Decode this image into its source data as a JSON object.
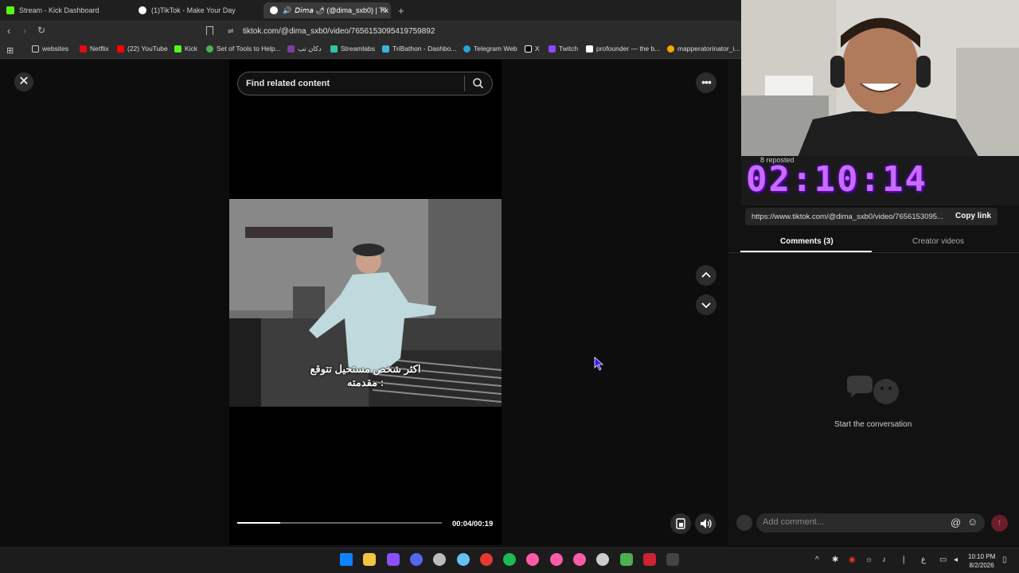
{
  "tabs": [
    {
      "title": "Stream - Kick Dashboard",
      "color": "#53fc18"
    },
    {
      "title": "(1)TikTok - Make Your Day",
      "color": "#ffffff"
    },
    {
      "title": "𝘋𝘪𝘮𝘢 🌶 (@dima_sxb0) | Tik",
      "color": "#ffffff"
    }
  ],
  "address": {
    "url": "tiktok.com/@dima_sxb0/video/7656153095419759892"
  },
  "bookmarks": [
    {
      "label": "websites",
      "color": "#cccccc"
    },
    {
      "label": "Netflix",
      "color": "#e50914"
    },
    {
      "label": "(22) YouTube",
      "color": "#ff0000"
    },
    {
      "label": "Kick",
      "color": "#53fc18"
    },
    {
      "label": "Set of Tools to Help...",
      "color": "#4caf50"
    },
    {
      "label": "دكان تب",
      "color": "#7b3fa0"
    },
    {
      "label": "Streamlabs",
      "color": "#31c3a2"
    },
    {
      "label": "TriBathon - Dashbo...",
      "color": "#3ab5d8"
    },
    {
      "label": "Telegram Web",
      "color": "#2aa1da"
    },
    {
      "label": "X",
      "color": "#ffffff"
    },
    {
      "label": "Twitch",
      "color": "#9146ff"
    },
    {
      "label": "profounder — the b...",
      "color": "#ffffff"
    },
    {
      "label": "mapperatorinator_i...",
      "color": "#f7a600"
    }
  ],
  "search": {
    "placeholder": "Find related content"
  },
  "video": {
    "caption_line1": "اكثر شخص مستحيل تتوقع",
    "caption_line2": "مقدمته :",
    "time": "00:04/00:19",
    "progress": 0.21
  },
  "overlay": {
    "timer": "02:10:14",
    "reposted": "8 reposted"
  },
  "panel": {
    "link": "https://www.tiktok.com/@dima_sxb0/video/7656153095...",
    "copy_link": "Copy link",
    "tab_comments": "Comments (3)",
    "tab_creator": "Creator videos",
    "empty": "Start the conversation",
    "comment_placeholder": "Add comment..."
  },
  "taskbar": {
    "time": "10:10 PM",
    "date": "8/2/2026",
    "lang": "ع",
    "apps": [
      "#0a84ff",
      "#f4c542",
      "#8a4fff",
      "#5865f2",
      "#bbbbbb",
      "#66c0f4",
      "#e53935",
      "#1db954",
      "#ff5aa5",
      "#ff5aa5",
      "#ff5aa5",
      "#cccccc",
      "#4caf50",
      "#cc2233",
      "#444444"
    ]
  }
}
